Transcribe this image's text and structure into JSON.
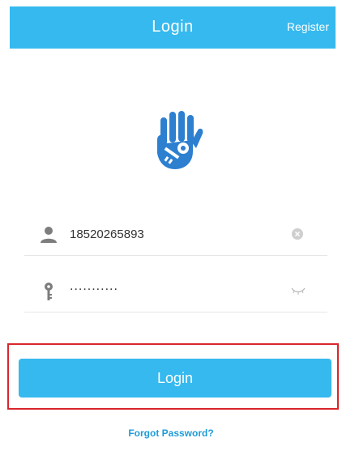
{
  "header": {
    "title": "Login",
    "register_label": "Register"
  },
  "logo": {
    "icon": "hand-key-icon"
  },
  "username": {
    "value": "18520265893",
    "icon": "user-icon",
    "clear_icon": "clear-icon"
  },
  "password": {
    "value": "...........",
    "icon": "key-icon",
    "visibility_icon": "eye-closed-icon"
  },
  "login_button": {
    "label": "Login"
  },
  "forgot_password": {
    "label": "Forgot Password?"
  },
  "colors": {
    "primary": "#36b9ee",
    "link": "#1e9bd7",
    "highlight": "#d9262c",
    "logo": "#2d7fd0"
  }
}
